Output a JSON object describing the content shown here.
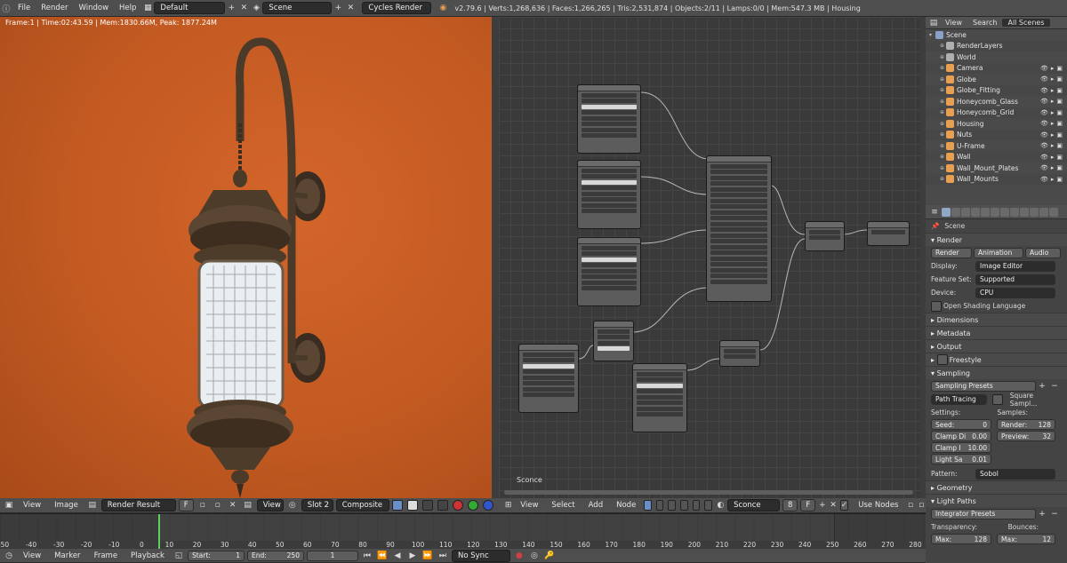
{
  "top": {
    "menus": [
      "File",
      "Render",
      "Window",
      "Help"
    ],
    "screen_layout": "Default",
    "scene": "Scene",
    "engine": "Cycles Render",
    "stats": "v2.79.6 | Verts:1,268,636 | Faces:1,266,265 | Tris:2,531,874 | Objects:2/11 | Lamps:0/0 | Mem:547.3 MB | Housing"
  },
  "render_view": {
    "info": "Frame:1 | Time:02:43.59 | Mem:1830.66M, Peak: 1877.24M"
  },
  "image_editor_header": {
    "menus": [
      "View",
      "Image"
    ],
    "image": "Render Result",
    "f_label": "F",
    "view": "View",
    "slot": "Slot 2",
    "pass": "Composite"
  },
  "node_editor": {
    "tree_label": "Sconce",
    "menus": [
      "View",
      "Select",
      "Add",
      "Node"
    ],
    "material": "Sconce",
    "material_users": "8",
    "f_label": "F",
    "use_nodes": "Use Nodes"
  },
  "outliner": {
    "tabs": [
      "View",
      "Search",
      "All Scenes"
    ],
    "items": [
      {
        "label": "Scene",
        "color": "#8aa0c8",
        "indent": 0
      },
      {
        "label": "RenderLayers",
        "color": "#b0b0b0",
        "indent": 1
      },
      {
        "label": "World",
        "color": "#b0b0b0",
        "indent": 1
      },
      {
        "label": "Camera",
        "color": "#e8a050",
        "indent": 1
      },
      {
        "label": "Globe",
        "color": "#e8a050",
        "indent": 1
      },
      {
        "label": "Globe_Fitting",
        "color": "#e8a050",
        "indent": 1
      },
      {
        "label": "Honeycomb_Glass",
        "color": "#e8a050",
        "indent": 1
      },
      {
        "label": "Honeycomb_Grid",
        "color": "#e8a050",
        "indent": 1
      },
      {
        "label": "Housing",
        "color": "#e8a050",
        "indent": 1
      },
      {
        "label": "Nuts",
        "color": "#e8a050",
        "indent": 1
      },
      {
        "label": "U-Frame",
        "color": "#e8a050",
        "indent": 1
      },
      {
        "label": "Wall",
        "color": "#e8a050",
        "indent": 1
      },
      {
        "label": "Wall_Mount_Plates",
        "color": "#e8a050",
        "indent": 1
      },
      {
        "label": "Wall_Mounts",
        "color": "#e8a050",
        "indent": 1
      }
    ]
  },
  "properties": {
    "scene_label": "Scene",
    "render_section": "Render",
    "render_buttons": [
      "Render",
      "Animation",
      "Audio"
    ],
    "display_label": "Display:",
    "display_value": "Image Editor",
    "feature_set_label": "Feature Set:",
    "feature_set_value": "Supported",
    "device_label": "Device:",
    "device_value": "CPU",
    "osl_label": "Open Shading Language",
    "collapsed_sections": [
      "Dimensions",
      "Metadata",
      "Output"
    ],
    "freestyle": "Freestyle",
    "sampling_section": "Sampling",
    "sampling_presets": "Sampling Presets",
    "path_tracing": "Path Tracing",
    "square_samples": "Square Sampl...",
    "settings_label": "Settings:",
    "samples_label": "Samples:",
    "seed": "Seed:",
    "seed_value": "0",
    "clamp_direct": "Clamp Di",
    "clamp_direct_value": "0.00",
    "clamp_indirect": "Clamp I",
    "clamp_indirect_value": "10.00",
    "light_sampling": "Light Sa",
    "light_sampling_value": "0.01",
    "render_samples_label": "Render:",
    "render_samples": "128",
    "preview_samples_label": "Preview:",
    "preview_samples": "32",
    "pattern_label": "Pattern:",
    "pattern_value": "Sobol",
    "geometry": "Geometry",
    "light_paths": "Light Paths",
    "integrator_presets": "Integrator Presets",
    "transparency": "Transparency:",
    "bounces": "Bounces:",
    "max_label": "Max:",
    "max_transp": "128",
    "max_bounces": "12"
  },
  "timeline": {
    "ticks": [
      "-50",
      "-40",
      "-30",
      "-20",
      "-10",
      "0",
      "10",
      "20",
      "30",
      "40",
      "50",
      "60",
      "70",
      "80",
      "90",
      "100",
      "110",
      "120",
      "130",
      "140",
      "150",
      "160",
      "170",
      "180",
      "190",
      "200",
      "210",
      "220",
      "230",
      "240",
      "250",
      "260",
      "270",
      "280"
    ],
    "menus": [
      "View",
      "Marker",
      "Frame",
      "Playback"
    ],
    "start_label": "Start:",
    "start": "1",
    "end_label": "End:",
    "end": "250",
    "current": "1",
    "sync": "No Sync"
  }
}
